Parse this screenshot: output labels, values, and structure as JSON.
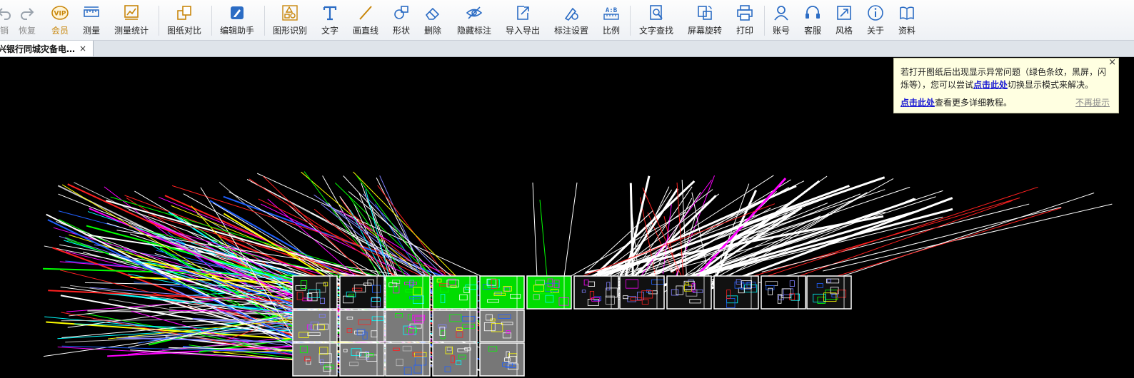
{
  "toolbar": {
    "items": [
      {
        "id": "undo",
        "label": "销"
      },
      {
        "id": "redo",
        "label": "恢复"
      },
      {
        "id": "vip",
        "label": "会员",
        "badge": "VIP"
      },
      {
        "id": "measure",
        "label": "测量"
      },
      {
        "id": "measure-stats",
        "label": "测量统计"
      },
      {
        "id": "compare",
        "label": "图纸对比"
      },
      {
        "id": "edit-assist",
        "label": "编辑助手"
      },
      {
        "id": "shape-recog",
        "label": "图形识别"
      },
      {
        "id": "text",
        "label": "文字"
      },
      {
        "id": "line",
        "label": "画直线"
      },
      {
        "id": "shape",
        "label": "形状"
      },
      {
        "id": "delete",
        "label": "删除"
      },
      {
        "id": "hide-mark",
        "label": "隐藏标注"
      },
      {
        "id": "import-export",
        "label": "导入导出"
      },
      {
        "id": "mark-settings",
        "label": "标注设置"
      },
      {
        "id": "scale",
        "label": "比例",
        "icon_text": "A:B"
      },
      {
        "id": "text-search",
        "label": "文字查找"
      },
      {
        "id": "rotate",
        "label": "屏幕旋转"
      },
      {
        "id": "print",
        "label": "打印"
      },
      {
        "id": "account",
        "label": "账号"
      },
      {
        "id": "service",
        "label": "客服"
      },
      {
        "id": "style",
        "label": "风格"
      },
      {
        "id": "about",
        "label": "关于"
      },
      {
        "id": "docs",
        "label": "资料"
      }
    ]
  },
  "tab": {
    "title": "兴银行同城灾备电…",
    "close": "×"
  },
  "notice": {
    "line1_prefix": "若打开图纸后出现显示异常问题（绿色条纹，黑屏，闪烁等），您可以尝试",
    "line1_link": "点击此处",
    "line1_suffix": "切换显示模式来解决。",
    "line2_link": "点击此处",
    "line2_suffix": "查看更多详细教程。",
    "dismiss": "不再提示",
    "close": "×"
  },
  "colors": {
    "accent": "#2b6cc4",
    "vip": "#c8860a",
    "canvas": "#000000",
    "notice_bg": "#ffffe1",
    "link": "#1a1ad4"
  }
}
